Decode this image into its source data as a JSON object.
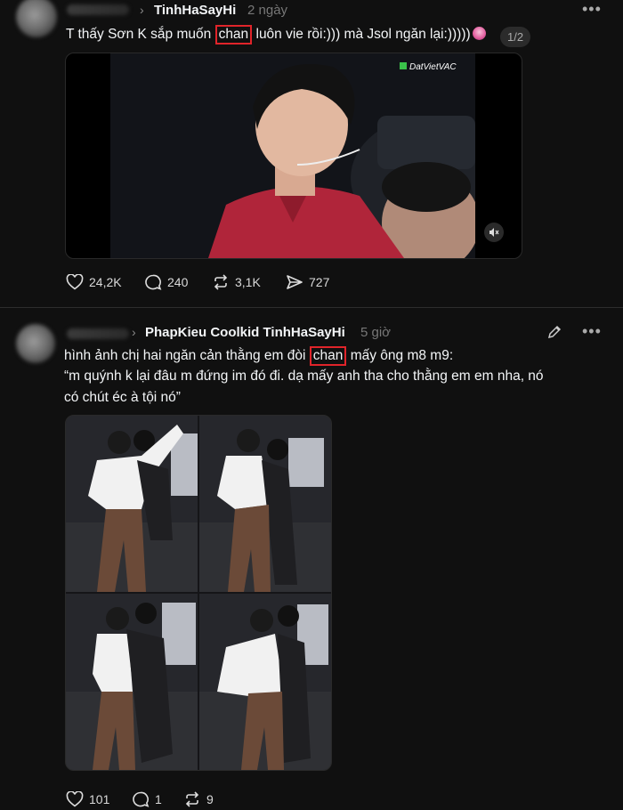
{
  "post1": {
    "username": "TinhHaSayHi",
    "time": "2 ngày",
    "text_before": "T thấy Sơn K sắp muốn ",
    "highlight": "chan",
    "text_after": " luôn vie rồi:))) mà Jsol ngăn lại:)))))",
    "pager": "1/2",
    "watermark": "DatVietVAC",
    "actions": {
      "likes": "24,2K",
      "comments": "240",
      "reposts": "3,1K",
      "shares": "727"
    }
  },
  "post2": {
    "usernames": "PhapKieu Coolkid TinhHaSayHi",
    "time": "5 giờ",
    "line1_before": "hình ảnh chị hai ngăn cản thằng em đòi ",
    "highlight": "chan",
    "line1_after": " mấy ông m8 m9:",
    "line2": "“m quýnh k lại đâu m đứng im đó đi. dạ mấy anh tha cho thằng em em nha, nó",
    "line3": "có chút éc à tội nó”",
    "actions": {
      "likes": "101",
      "comments": "1",
      "reposts": "9"
    }
  },
  "icons": {
    "more": "more-dots-icon",
    "chevron": "chevron-right-icon",
    "edit": "pencil-icon",
    "mute": "speaker-muted-icon",
    "heart": "heart-icon",
    "comment": "comment-bubble-icon",
    "repost": "repost-icon",
    "share": "send-icon"
  },
  "colors": {
    "background": "#101010",
    "highlight_box": "#e0242a",
    "muted_text": "#777777"
  }
}
